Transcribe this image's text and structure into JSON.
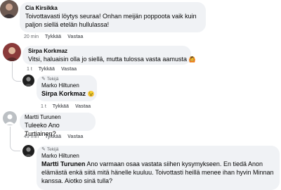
{
  "comments": [
    {
      "author": "Cia Kirsikka",
      "text": "Toivottavasti löytys seuraa! Onhan meijän poppoota vaik kuin paljon siellä etelän hullulassa!",
      "time": "20 min",
      "like": "Tykkää",
      "reply": "Vastaa"
    },
    {
      "author": "Sirpa Korkmaz",
      "text": "Vitsi, haluaisin olla jo siellä, mutta tulossa vasta aamusta",
      "emoji": "🙆",
      "time": "1 t",
      "like": "Tykkää",
      "reply": "Vastaa"
    },
    {
      "badge": "Tekijä",
      "author": "Marko Hiltunen",
      "mention": "Sirpa Korkmaz",
      "emoji": "😉",
      "time": "1 t",
      "like": "Tykkää",
      "reply": "Vastaa"
    },
    {
      "author": "Martti Turunen",
      "text": "Tuleeko Ano Turtiainen?",
      "time": "49 min",
      "like": "Tykkää",
      "reply": "Vastaa"
    },
    {
      "badge": "Tekijä",
      "author": "Marko Hiltunen",
      "mention": "Martti Turunen",
      "text": "Ano varmaan osaa vastata siihen kysymykseen. En tiedä Anon elämästä enkä siitä mitä hänelle kuuluu. Toivottasti heillä menee ihan hyvin Minnan kanssa. Aiotko sinä tulla?"
    }
  ],
  "colors": {
    "bubble": "#f0f2f5",
    "meta": "#65676b",
    "text": "#050505",
    "thread_line": "#ced0d4"
  }
}
